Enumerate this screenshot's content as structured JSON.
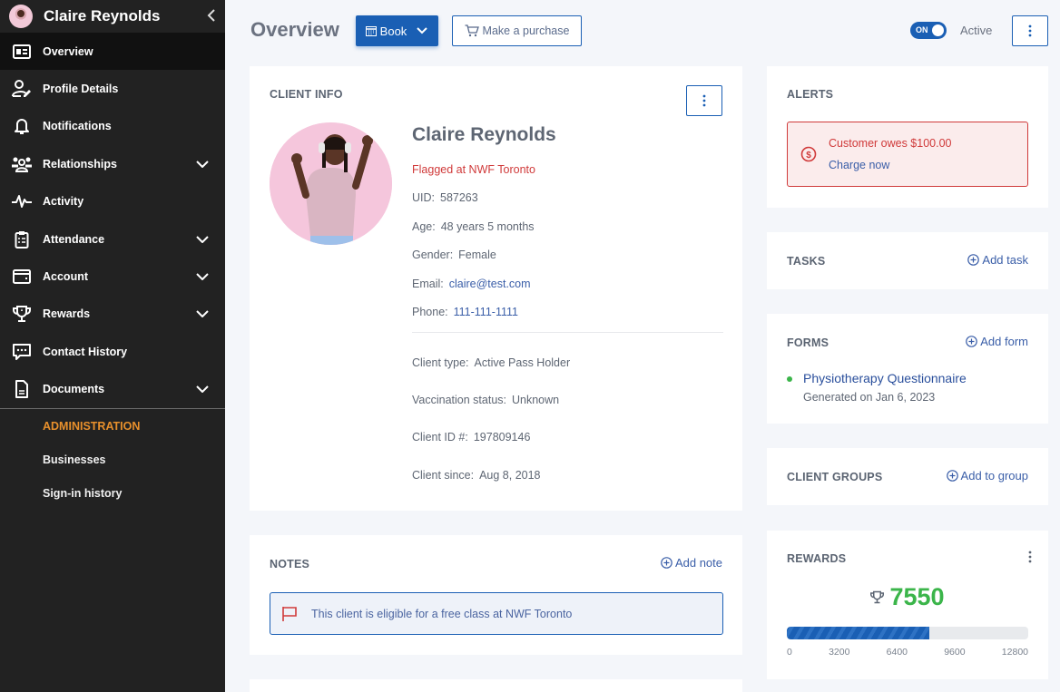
{
  "sidebar": {
    "user_name": "Claire Reynolds",
    "items": [
      {
        "label": "Overview",
        "icon": "id-card-icon",
        "active": true,
        "expandable": false
      },
      {
        "label": "Profile Details",
        "icon": "user-edit-icon",
        "active": false,
        "expandable": false
      },
      {
        "label": "Notifications",
        "icon": "bell-icon",
        "active": false,
        "expandable": false
      },
      {
        "label": "Relationships",
        "icon": "users-icon",
        "active": false,
        "expandable": true
      },
      {
        "label": "Activity",
        "icon": "pulse-icon",
        "active": false,
        "expandable": false
      },
      {
        "label": "Attendance",
        "icon": "clipboard-icon",
        "active": false,
        "expandable": true
      },
      {
        "label": "Account",
        "icon": "wallet-icon",
        "active": false,
        "expandable": true
      },
      {
        "label": "Rewards",
        "icon": "trophy-icon",
        "active": false,
        "expandable": true
      },
      {
        "label": "Contact History",
        "icon": "chat-icon",
        "active": false,
        "expandable": false
      },
      {
        "label": "Documents",
        "icon": "document-icon",
        "active": false,
        "expandable": true
      }
    ],
    "section_title": "ADMINISTRATION",
    "sub_items": [
      "Businesses",
      "Sign-in history"
    ]
  },
  "topbar": {
    "title": "Overview",
    "book_label": "Book",
    "purchase_label": "Make a purchase",
    "toggle_label": "ON",
    "toggle_on": true,
    "status_label": "Active"
  },
  "client_info": {
    "title": "CLIENT INFO",
    "name": "Claire Reynolds",
    "flag": "Flagged at NWF Toronto",
    "uid_label": "UID:",
    "uid": "587263",
    "age_label": "Age:",
    "age": "48 years 5 months",
    "gender_label": "Gender:",
    "gender": "Female",
    "email_label": "Email:",
    "email": "claire@test.com",
    "phone_label": "Phone:",
    "phone": "111-111-1111",
    "client_type_label": "Client type:",
    "client_type": "Active Pass Holder",
    "vaccination_label": "Vaccination status:",
    "vaccination": "Unknown",
    "client_id_label": "Client ID #:",
    "client_id": "197809146",
    "client_since_label": "Client since:",
    "client_since": "Aug 8, 2018"
  },
  "notes": {
    "title": "NOTES",
    "add_label": "Add note",
    "items": [
      "This client is eligible for a free class at NWF Toronto"
    ]
  },
  "alerts": {
    "title": "ALERTS",
    "message": "Customer owes $100.00",
    "action": "Charge now"
  },
  "tasks": {
    "title": "TASKS",
    "add_label": "Add task"
  },
  "forms": {
    "title": "FORMS",
    "add_label": "Add form",
    "items": [
      {
        "name": "Physiotherapy Questionnaire",
        "sub": "Generated on Jan 6, 2023",
        "status_color": "#3bb54a"
      }
    ]
  },
  "client_groups": {
    "title": "CLIENT GROUPS",
    "add_label": "Add to group"
  },
  "rewards": {
    "title": "REWARDS",
    "points": "7550",
    "points_value": 7550,
    "max": 12800,
    "ticks": [
      "0",
      "3200",
      "6400",
      "9600",
      "12800"
    ]
  },
  "colors": {
    "primary": "#1a5fb4",
    "danger": "#d03a3a",
    "success": "#3bb54a",
    "admin_accent": "#e8902c",
    "sidebar_bg": "#222222"
  }
}
